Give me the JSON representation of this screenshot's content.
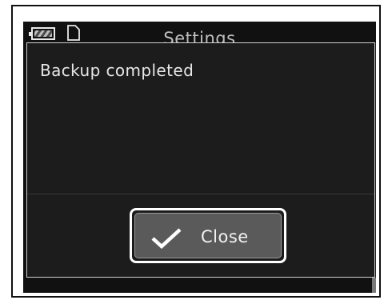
{
  "status_bar": {
    "battery_icon": "battery-icon",
    "card_icon": "memory-card-icon"
  },
  "screen": {
    "title": "Settings"
  },
  "dialog": {
    "message": "Backup completed",
    "close_button": {
      "label": "Close",
      "icon": "checkmark-icon"
    }
  },
  "colors": {
    "screen_bg": "#111111",
    "dialog_bg": "#1c1c1c",
    "button_bg": "#5a5a5a",
    "text": "#e6e6e6"
  }
}
